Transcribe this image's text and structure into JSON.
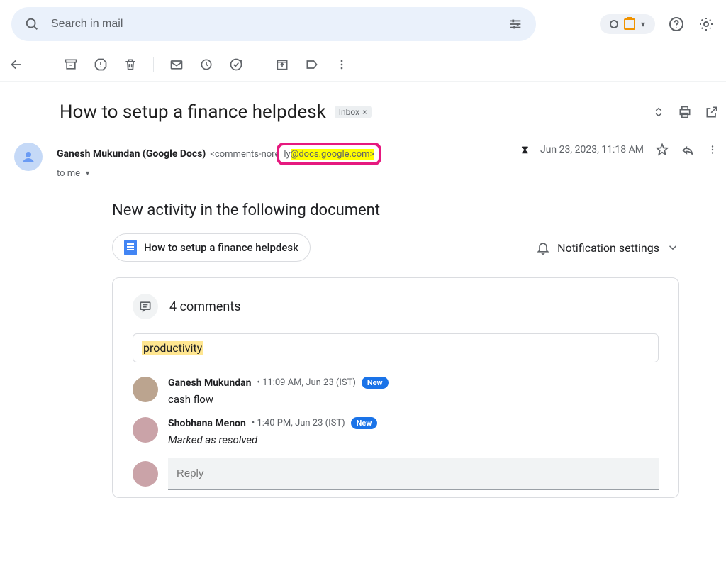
{
  "search": {
    "placeholder": "Search in mail"
  },
  "subject": {
    "text": "How to setup a finance helpdesk",
    "label": "Inbox"
  },
  "sender": {
    "name": "Ganesh Mukundan (Google Docs)",
    "addr_prefix": "<comments-nore",
    "addr_mid": "ly",
    "addr_suffix": "@docs.google.com>",
    "to": "to me",
    "date": "Jun 23, 2023, 11:18 AM"
  },
  "body": {
    "activity_title": "New activity in the following document",
    "doc_title": "How to setup a finance helpdesk",
    "notif_label": "Notification settings"
  },
  "card": {
    "count_label": "4 comments",
    "topic": "productivity",
    "reply_placeholder": "Reply",
    "new_label": "New",
    "comments": [
      {
        "name": "Ganesh Mukundan",
        "time": "11:09 AM, Jun 23 (IST)",
        "text": "cash flow",
        "italic": false
      },
      {
        "name": "Shobhana Menon",
        "time": "1:40 PM, Jun 23 (IST)",
        "text": "Marked as resolved",
        "italic": true
      }
    ]
  }
}
